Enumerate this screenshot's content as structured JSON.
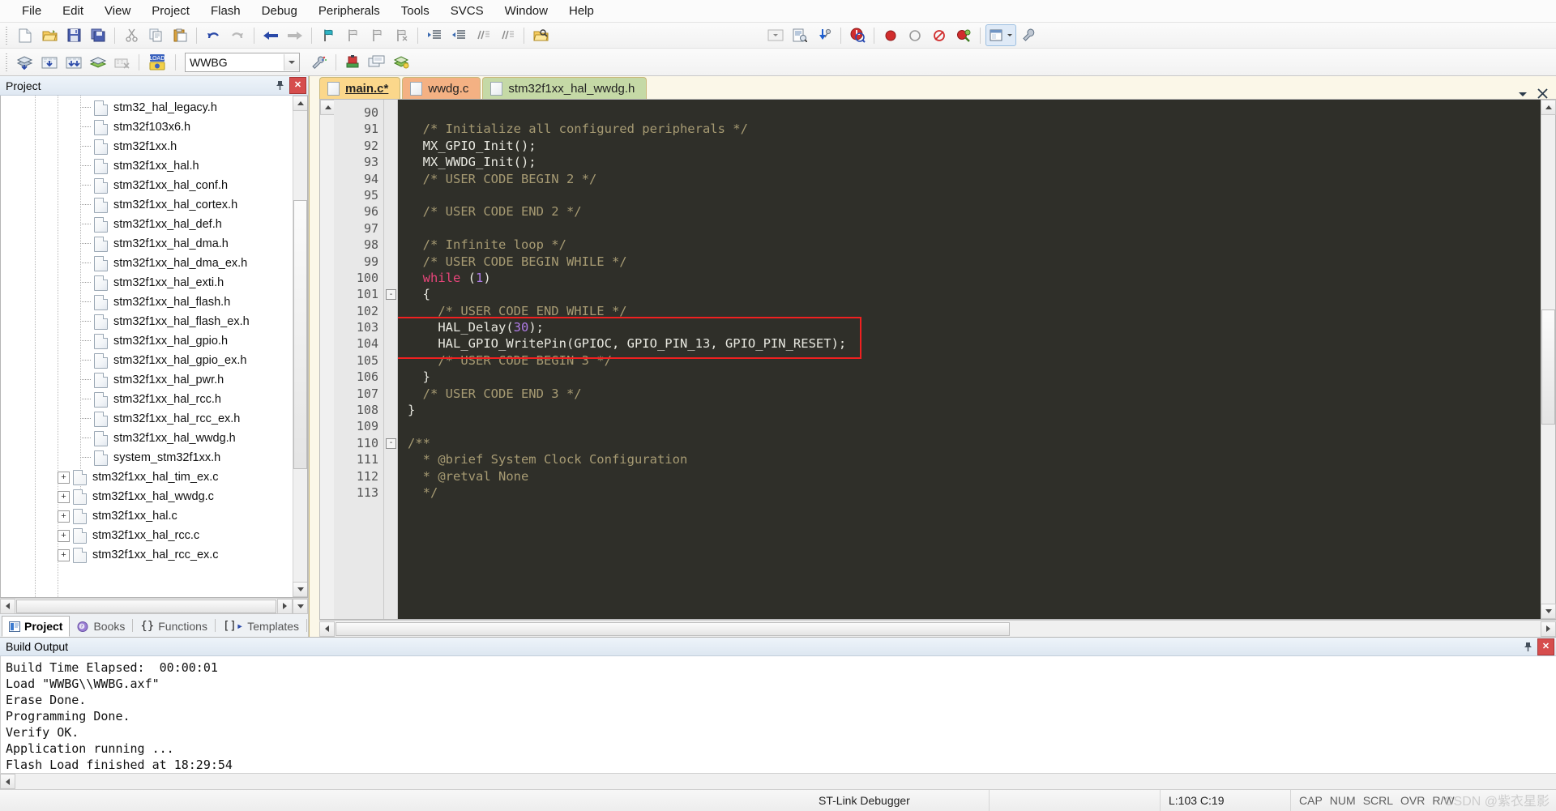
{
  "window": {
    "title": "Keil uVision"
  },
  "menubar": {
    "items": [
      {
        "label": "File"
      },
      {
        "label": "Edit"
      },
      {
        "label": "View"
      },
      {
        "label": "Project"
      },
      {
        "label": "Flash"
      },
      {
        "label": "Debug"
      },
      {
        "label": "Peripherals"
      },
      {
        "label": "Tools"
      },
      {
        "label": "SVCS"
      },
      {
        "label": "Window"
      },
      {
        "label": "Help"
      }
    ]
  },
  "toolbar": {
    "icons": [
      "new-file-icon",
      "open-file-icon",
      "save-icon",
      "save-all-icon",
      "cut-icon",
      "copy-icon",
      "paste-icon",
      "undo-icon",
      "redo-icon",
      "navigate-back-icon",
      "navigate-forward-icon",
      "bookmark-toggle-icon",
      "bookmark-prev-icon",
      "bookmark-next-icon",
      "bookmark-clear-icon",
      "indent-right-icon",
      "indent-left-icon",
      "comment-icon",
      "uncomment-icon",
      "find-in-files-icon",
      "dropdown-arrow-icon",
      "configure-target-icon",
      "debug-settings-icon",
      "start-debug-icon",
      "insert-breakpoint-icon",
      "disable-breakpoint-icon",
      "kill-breakpoints-icon",
      "disable-all-breakpoints-icon",
      "manage-windows-icon",
      "configure-icon"
    ]
  },
  "toolbar2": {
    "icons": [
      "translate-icon",
      "build-icon",
      "rebuild-icon",
      "batch-build-icon",
      "stop-build-icon",
      "download-icon"
    ],
    "target_value": "WWBG",
    "right_icons": [
      "manage-runtime-icon",
      "target-options-icon",
      "multi-project-icon",
      "pack-installer-icon"
    ]
  },
  "project_pane": {
    "title": "Project",
    "pin_icon": "pin-icon",
    "close_icon": "close-icon",
    "tree": [
      {
        "label": "stm32_hal_legacy.h",
        "type": "h",
        "depth": 3
      },
      {
        "label": "stm32f103x6.h",
        "type": "h",
        "depth": 3
      },
      {
        "label": "stm32f1xx.h",
        "type": "h",
        "depth": 3
      },
      {
        "label": "stm32f1xx_hal.h",
        "type": "h",
        "depth": 3
      },
      {
        "label": "stm32f1xx_hal_conf.h",
        "type": "h",
        "depth": 3
      },
      {
        "label": "stm32f1xx_hal_cortex.h",
        "type": "h",
        "depth": 3
      },
      {
        "label": "stm32f1xx_hal_def.h",
        "type": "h",
        "depth": 3
      },
      {
        "label": "stm32f1xx_hal_dma.h",
        "type": "h",
        "depth": 3
      },
      {
        "label": "stm32f1xx_hal_dma_ex.h",
        "type": "h",
        "depth": 3
      },
      {
        "label": "stm32f1xx_hal_exti.h",
        "type": "h",
        "depth": 3
      },
      {
        "label": "stm32f1xx_hal_flash.h",
        "type": "h",
        "depth": 3
      },
      {
        "label": "stm32f1xx_hal_flash_ex.h",
        "type": "h",
        "depth": 3
      },
      {
        "label": "stm32f1xx_hal_gpio.h",
        "type": "h",
        "depth": 3
      },
      {
        "label": "stm32f1xx_hal_gpio_ex.h",
        "type": "h",
        "depth": 3
      },
      {
        "label": "stm32f1xx_hal_pwr.h",
        "type": "h",
        "depth": 3
      },
      {
        "label": "stm32f1xx_hal_rcc.h",
        "type": "h",
        "depth": 3
      },
      {
        "label": "stm32f1xx_hal_rcc_ex.h",
        "type": "h",
        "depth": 3
      },
      {
        "label": "stm32f1xx_hal_wwdg.h",
        "type": "h",
        "depth": 3
      },
      {
        "label": "system_stm32f1xx.h",
        "type": "h",
        "depth": 3
      },
      {
        "label": "stm32f1xx_hal_tim_ex.c",
        "type": "c",
        "depth": 2,
        "expander": "+"
      },
      {
        "label": "stm32f1xx_hal_wwdg.c",
        "type": "c",
        "depth": 2,
        "expander": "+"
      },
      {
        "label": "stm32f1xx_hal.c",
        "type": "c",
        "depth": 2,
        "expander": "+"
      },
      {
        "label": "stm32f1xx_hal_rcc.c",
        "type": "c",
        "depth": 2,
        "expander": "+"
      },
      {
        "label": "stm32f1xx_hal_rcc_ex.c",
        "type": "c",
        "depth": 2,
        "expander": "+"
      }
    ],
    "tabs": [
      {
        "label": "Project",
        "icon": "project-icon",
        "active": true
      },
      {
        "label": "Books",
        "icon": "books-icon",
        "active": false
      },
      {
        "label": "Functions",
        "icon": "functions-icon",
        "active": false
      },
      {
        "label": "Templates",
        "icon": "templates-icon",
        "active": false
      }
    ]
  },
  "editor": {
    "tabs": [
      {
        "label": "main.c*",
        "theme": "t-main",
        "active": true
      },
      {
        "label": "wwdg.c",
        "theme": "t-wwdg",
        "active": false
      },
      {
        "label": "stm32f1xx_hal_wwdg.h",
        "theme": "t-hdr",
        "active": false
      }
    ],
    "tabs_right_icons": [
      "chevron-down-icon",
      "close-tab-icon"
    ],
    "first_line_number": 90,
    "lines": [
      {
        "n": 90,
        "fold": "",
        "tokens": []
      },
      {
        "n": 91,
        "fold": "",
        "tokens": [
          {
            "t": "  /* Initialize all configured peripherals */",
            "c": "cm"
          }
        ]
      },
      {
        "n": 92,
        "fold": "",
        "tokens": [
          {
            "t": "  MX_GPIO_Init();",
            "c": "pl"
          }
        ]
      },
      {
        "n": 93,
        "fold": "",
        "tokens": [
          {
            "t": "  MX_WWDG_Init();",
            "c": "pl"
          }
        ]
      },
      {
        "n": 94,
        "fold": "",
        "tokens": [
          {
            "t": "  /* USER CODE BEGIN 2 */",
            "c": "cm"
          }
        ]
      },
      {
        "n": 95,
        "fold": "",
        "tokens": []
      },
      {
        "n": 96,
        "fold": "",
        "tokens": [
          {
            "t": "  /* USER CODE END 2 */",
            "c": "cm"
          }
        ]
      },
      {
        "n": 97,
        "fold": "",
        "tokens": []
      },
      {
        "n": 98,
        "fold": "",
        "tokens": [
          {
            "t": "  /* Infinite loop */",
            "c": "cm"
          }
        ]
      },
      {
        "n": 99,
        "fold": "",
        "tokens": [
          {
            "t": "  /* USER CODE BEGIN WHILE */",
            "c": "cm"
          }
        ]
      },
      {
        "n": 100,
        "fold": "",
        "tokens": [
          {
            "t": "  ",
            "c": "pl"
          },
          {
            "t": "while",
            "c": "kw"
          },
          {
            "t": " (",
            "c": "pl"
          },
          {
            "t": "1",
            "c": "num"
          },
          {
            "t": ")",
            "c": "pl"
          }
        ]
      },
      {
        "n": 101,
        "fold": "-",
        "tokens": [
          {
            "t": "  {",
            "c": "pl"
          }
        ]
      },
      {
        "n": 102,
        "fold": "",
        "tokens": [
          {
            "t": "    /* USER CODE END WHILE */",
            "c": "cm"
          }
        ]
      },
      {
        "n": 103,
        "fold": "",
        "tokens": [
          {
            "t": "    HAL_Delay(",
            "c": "pl"
          },
          {
            "t": "30",
            "c": "num"
          },
          {
            "t": ");",
            "c": "pl"
          }
        ]
      },
      {
        "n": 104,
        "fold": "",
        "tokens": [
          {
            "t": "    HAL_GPIO_WritePin(GPIOC, GPIO_PIN_13, GPIO_PIN_RESET);",
            "c": "pl"
          }
        ]
      },
      {
        "n": 105,
        "fold": "",
        "tokens": [
          {
            "t": "    /* USER CODE BEGIN 3 */",
            "c": "cm"
          }
        ]
      },
      {
        "n": 106,
        "fold": "",
        "tokens": [
          {
            "t": "  }",
            "c": "pl"
          }
        ]
      },
      {
        "n": 107,
        "fold": "",
        "tokens": [
          {
            "t": "  /* USER CODE END 3 */",
            "c": "cm"
          }
        ]
      },
      {
        "n": 108,
        "fold": "",
        "tokens": [
          {
            "t": "}",
            "c": "pl"
          }
        ]
      },
      {
        "n": 109,
        "fold": "",
        "tokens": []
      },
      {
        "n": 110,
        "fold": "-",
        "tokens": [
          {
            "t": "/**",
            "c": "cm"
          }
        ]
      },
      {
        "n": 111,
        "fold": "",
        "tokens": [
          {
            "t": "  * @brief System Clock Configuration",
            "c": "cm"
          }
        ]
      },
      {
        "n": 112,
        "fold": "",
        "tokens": [
          {
            "t": "  * @retval None",
            "c": "cm"
          }
        ]
      },
      {
        "n": 113,
        "fold": "",
        "tokens": [
          {
            "t": "  */",
            "c": "cm"
          }
        ]
      }
    ],
    "highlight_color": "#f02020"
  },
  "build_output": {
    "title": "Build Output",
    "pin_icon": "pin-icon",
    "close_icon": "close-icon",
    "lines": [
      "Build Time Elapsed:  00:00:01",
      "Load \"WWBG\\\\WWBG.axf\"",
      "Erase Done.",
      "Programming Done.",
      "Verify OK.",
      "Application running ...",
      "Flash Load finished at 18:29:54"
    ]
  },
  "statusbar": {
    "debugger": "ST-Link Debugger",
    "cursor": "L:103 C:19",
    "flags": [
      "CAP",
      "NUM",
      "SCRL",
      "OVR",
      "R/W"
    ],
    "watermark": "CSDN @紫衣星影"
  }
}
